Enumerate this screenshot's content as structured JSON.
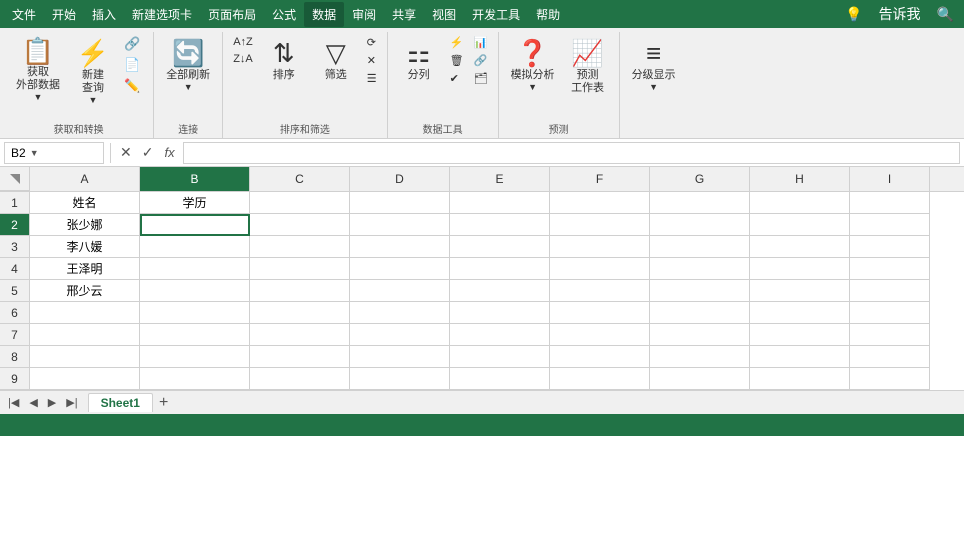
{
  "menuBar": {
    "items": [
      "文件",
      "开始",
      "插入",
      "新建选项卡",
      "页面布局",
      "公式",
      "数据",
      "审阅",
      "共享",
      "视图",
      "开发工具",
      "帮助"
    ],
    "activeItem": "数据",
    "lightbulb": "💡",
    "tellMe": "告诉我",
    "searchIcon": "🔍"
  },
  "ribbon": {
    "activeTab": "数据",
    "groups": [
      {
        "name": "获取和转换",
        "label": "获取和转换",
        "buttons": [
          {
            "icon": "📋",
            "label": "获取\n外部数据"
          },
          {
            "icon": "⚡",
            "label": "新建\n查询"
          }
        ]
      },
      {
        "name": "连接",
        "label": "连接",
        "buttons": [
          {
            "icon": "🔄",
            "label": "全部刷新"
          }
        ]
      },
      {
        "name": "排序和筛选",
        "label": "排序和筛选",
        "buttons": [
          {
            "icon": "↕",
            "label": "排序"
          },
          {
            "icon": "▽",
            "label": "筛选"
          }
        ]
      },
      {
        "name": "数据工具",
        "label": "数据工具",
        "buttons": [
          {
            "icon": "⚏",
            "label": "分列"
          }
        ]
      },
      {
        "name": "预测",
        "label": "预测",
        "buttons": [
          {
            "icon": "❓",
            "label": "模拟分析"
          },
          {
            "icon": "📈",
            "label": "预测\n工作表"
          }
        ]
      },
      {
        "name": "分级显示",
        "label": "",
        "buttons": [
          {
            "icon": "≡",
            "label": "分级显\n示"
          }
        ]
      }
    ]
  },
  "formulaBar": {
    "nameBox": "B2",
    "cancelBtn": "✕",
    "confirmBtn": "✓",
    "fx": "fx",
    "formula": ""
  },
  "columns": [
    "A",
    "B",
    "C",
    "D",
    "E",
    "F",
    "G",
    "H",
    "I"
  ],
  "rows": [
    {
      "num": 1,
      "cells": [
        "姓名",
        "学历",
        "",
        "",
        "",
        "",
        "",
        "",
        ""
      ]
    },
    {
      "num": 2,
      "cells": [
        "张少娜",
        "",
        "",
        "",
        "",
        "",
        "",
        "",
        ""
      ]
    },
    {
      "num": 3,
      "cells": [
        "李八媛",
        "",
        "",
        "",
        "",
        "",
        "",
        "",
        ""
      ]
    },
    {
      "num": 4,
      "cells": [
        "王泽明",
        "",
        "",
        "",
        "",
        "",
        "",
        "",
        ""
      ]
    },
    {
      "num": 5,
      "cells": [
        "邢少云",
        "",
        "",
        "",
        "",
        "",
        "",
        "",
        ""
      ]
    },
    {
      "num": 6,
      "cells": [
        "",
        "",
        "",
        "",
        "",
        "",
        "",
        "",
        ""
      ]
    },
    {
      "num": 7,
      "cells": [
        "",
        "",
        "",
        "",
        "",
        "",
        "",
        "",
        ""
      ]
    },
    {
      "num": 8,
      "cells": [
        "",
        "",
        "",
        "",
        "",
        "",
        "",
        "",
        ""
      ]
    },
    {
      "num": 9,
      "cells": [
        "",
        "",
        "",
        "",
        "",
        "",
        "",
        "",
        ""
      ]
    }
  ],
  "sheetTabs": {
    "sheets": [
      "Sheet1"
    ],
    "activeSheet": "Sheet1"
  },
  "statusBar": {
    "text": ""
  },
  "activeCell": "B2"
}
